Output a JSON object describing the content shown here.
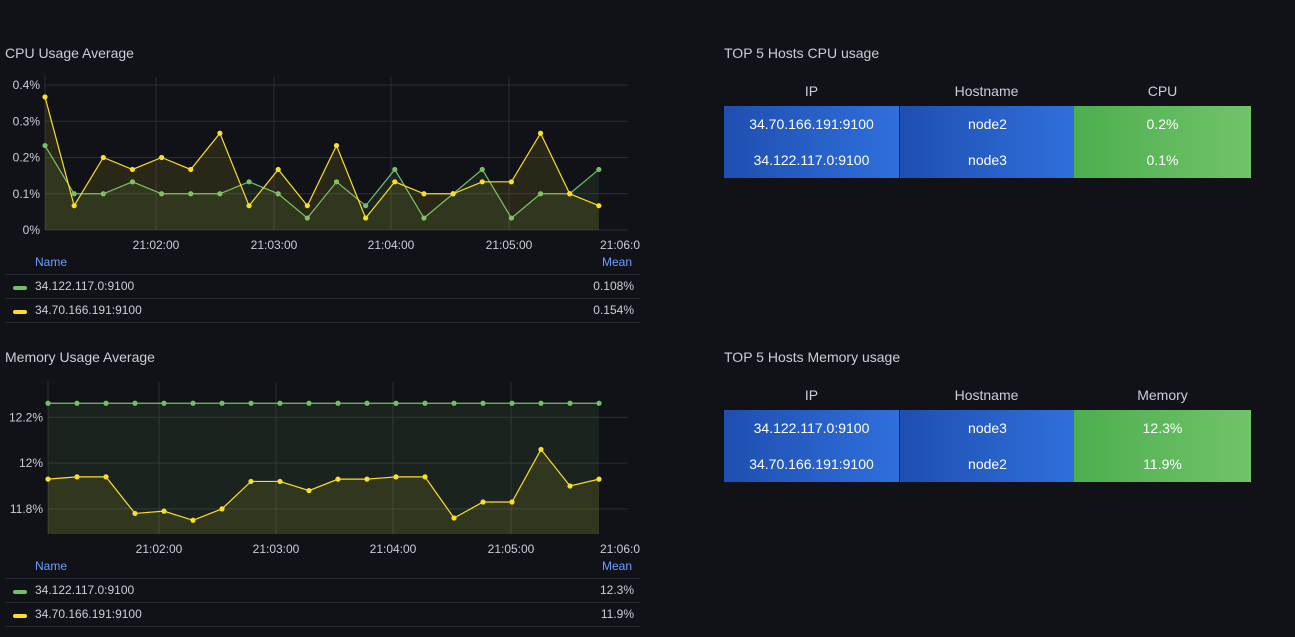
{
  "panels": {
    "cpu_title": "CPU Usage Average",
    "mem_title": "Memory Usage Average",
    "top_cpu_title": "TOP 5 Hosts CPU usage",
    "top_mem_title": "TOP 5 Hosts Memory usage"
  },
  "legend": {
    "name_header": "Name",
    "mean_header": "Mean"
  },
  "colors": {
    "green": "#73bf69",
    "yellow": "#fade2a"
  },
  "chart_data": [
    {
      "type": "line",
      "title": "CPU Usage Average",
      "x": [
        "21:01:00",
        "21:01:15",
        "21:01:30",
        "21:01:45",
        "21:02:00",
        "21:02:15",
        "21:02:30",
        "21:02:45",
        "21:03:00",
        "21:03:15",
        "21:03:30",
        "21:03:45",
        "21:04:00",
        "21:04:15",
        "21:04:30",
        "21:04:45",
        "21:05:00",
        "21:05:15",
        "21:05:30",
        "21:05:45",
        "21:06:00"
      ],
      "x_ticks": [
        "21:02:00",
        "21:03:00",
        "21:04:00",
        "21:05:00",
        "21:06:0"
      ],
      "y_ticks": [
        "0%",
        "0.1%",
        "0.2%",
        "0.3%",
        "0.4%"
      ],
      "ylim": [
        0,
        0.4
      ],
      "unit": "%",
      "grid": true,
      "series": [
        {
          "name": "34.122.117.0:9100",
          "color": "#73bf69",
          "mean": "0.108%",
          "values": [
            0.233,
            0.1,
            0.1,
            0.133,
            0.1,
            0.1,
            0.1,
            0.133,
            0.1,
            0.033,
            0.133,
            0.067,
            0.167,
            0.033,
            0.1,
            0.167,
            0.033,
            0.1,
            0.1,
            0.167
          ]
        },
        {
          "name": "34.70.166.191:9100",
          "color": "#fade2a",
          "mean": "0.154%",
          "values": [
            0.367,
            0.067,
            0.2,
            0.167,
            0.2,
            0.167,
            0.267,
            0.067,
            0.167,
            0.067,
            0.233,
            0.033,
            0.133,
            0.1,
            0.1,
            0.133,
            0.133,
            0.267,
            0.1,
            0.067
          ]
        }
      ]
    },
    {
      "type": "line",
      "title": "Memory Usage Average",
      "x": [
        "21:01:00",
        "21:01:15",
        "21:01:30",
        "21:01:45",
        "21:02:00",
        "21:02:15",
        "21:02:30",
        "21:02:45",
        "21:03:00",
        "21:03:15",
        "21:03:30",
        "21:03:45",
        "21:04:00",
        "21:04:15",
        "21:04:30",
        "21:04:45",
        "21:05:00",
        "21:05:15",
        "21:05:30",
        "21:05:45",
        "21:06:00"
      ],
      "x_ticks": [
        "21:02:00",
        "21:03:00",
        "21:04:00",
        "21:05:00",
        "21:06:0"
      ],
      "y_ticks": [
        "11.8%",
        "12%",
        "12.2%"
      ],
      "ylim": [
        11.69,
        12.32
      ],
      "unit": "%",
      "grid": true,
      "series": [
        {
          "name": "34.122.117.0:9100",
          "color": "#73bf69",
          "mean": "12.3%",
          "values": [
            12.262,
            12.262,
            12.262,
            12.262,
            12.262,
            12.262,
            12.262,
            12.262,
            12.262,
            12.262,
            12.262,
            12.262,
            12.262,
            12.262,
            12.262,
            12.262,
            12.262,
            12.262,
            12.262,
            12.262
          ]
        },
        {
          "name": "34.70.166.191:9100",
          "color": "#fade2a",
          "mean": "11.9%",
          "values": [
            11.93,
            11.94,
            11.94,
            11.78,
            11.79,
            11.75,
            11.8,
            11.92,
            11.92,
            11.88,
            11.93,
            11.93,
            11.94,
            11.94,
            11.76,
            11.83,
            11.83,
            12.06,
            11.9,
            11.93
          ]
        }
      ]
    }
  ],
  "top_cpu": {
    "headers": [
      "IP",
      "Hostname",
      "CPU"
    ],
    "rows": [
      [
        "34.70.166.191:9100",
        "node2",
        "0.2%"
      ],
      [
        "34.122.117.0:9100",
        "node3",
        "0.1%"
      ]
    ]
  },
  "top_mem": {
    "headers": [
      "IP",
      "Hostname",
      "Memory"
    ],
    "rows": [
      [
        "34.122.117.0:9100",
        "node3",
        "12.3%"
      ],
      [
        "34.70.166.191:9100",
        "node2",
        "11.9%"
      ]
    ]
  }
}
